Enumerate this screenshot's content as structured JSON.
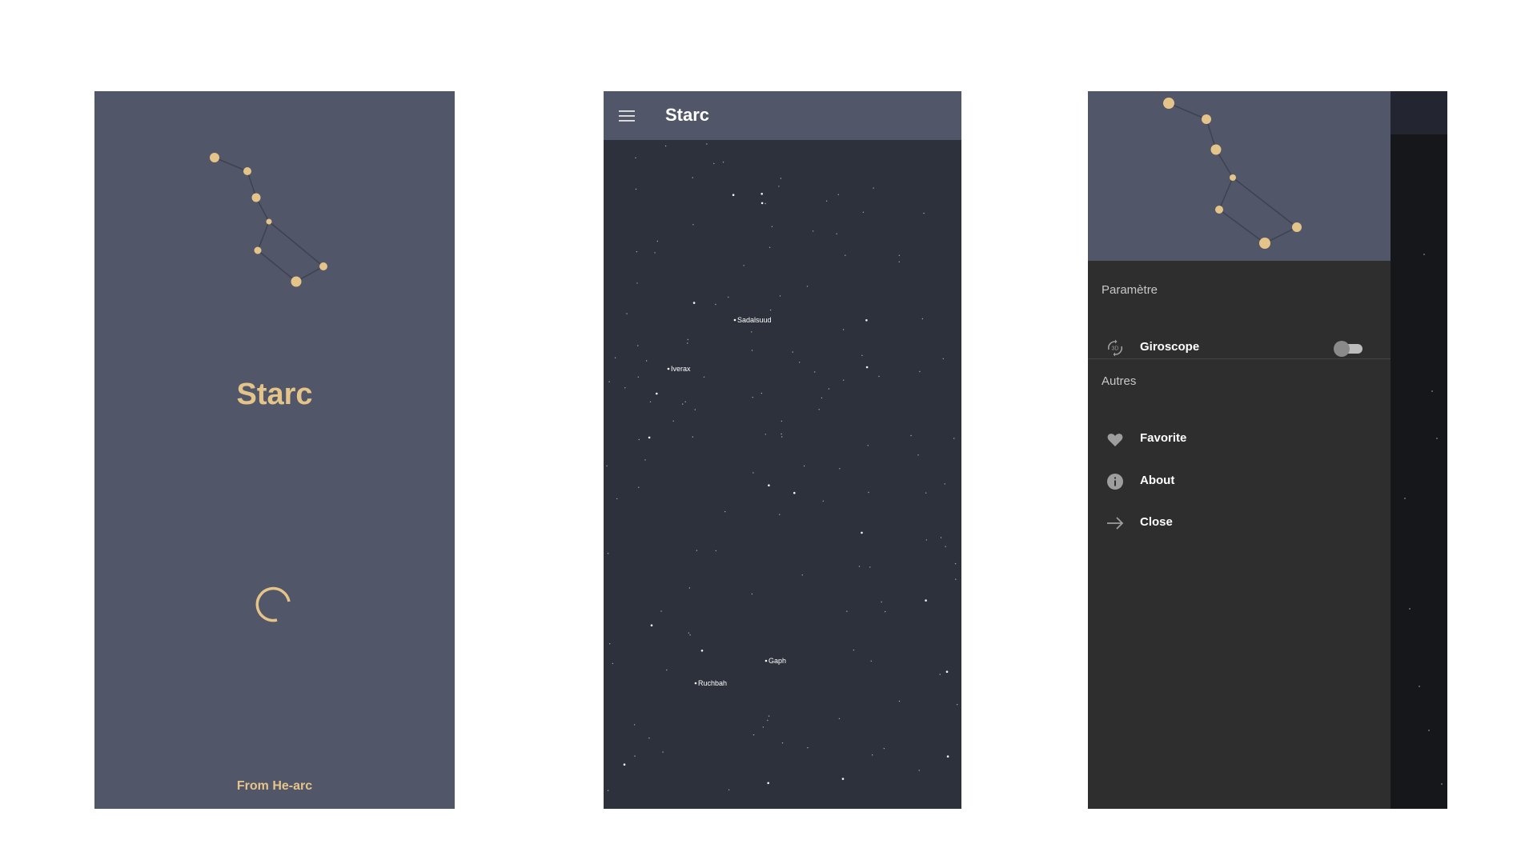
{
  "splash": {
    "title": "Starc",
    "footer": "From He-arc",
    "accent_color": "#e5c48a",
    "background_color": "#515768",
    "constellation_icon": "big-dipper-icon",
    "loading_icon": "loading-spinner-icon"
  },
  "skymap": {
    "appbar": {
      "title": "Starc",
      "menu_icon": "hamburger-menu-icon"
    },
    "background_color": "#2d313b",
    "star_labels": [
      "Sadalsuud",
      "Iverax",
      "Gaph",
      "Ruchbah"
    ]
  },
  "drawer": {
    "header_icon": "big-dipper-icon",
    "sections": [
      {
        "title": "Paramètre"
      },
      {
        "title": "Autres"
      }
    ],
    "items": [
      {
        "label": "Giroscope",
        "icon": "gyroscope-3d-icon",
        "toggle": {
          "on": false
        }
      },
      {
        "label": "Favorite",
        "icon": "heart-icon"
      },
      {
        "label": "About",
        "icon": "info-icon"
      },
      {
        "label": "Close",
        "icon": "arrow-right-icon"
      }
    ]
  }
}
